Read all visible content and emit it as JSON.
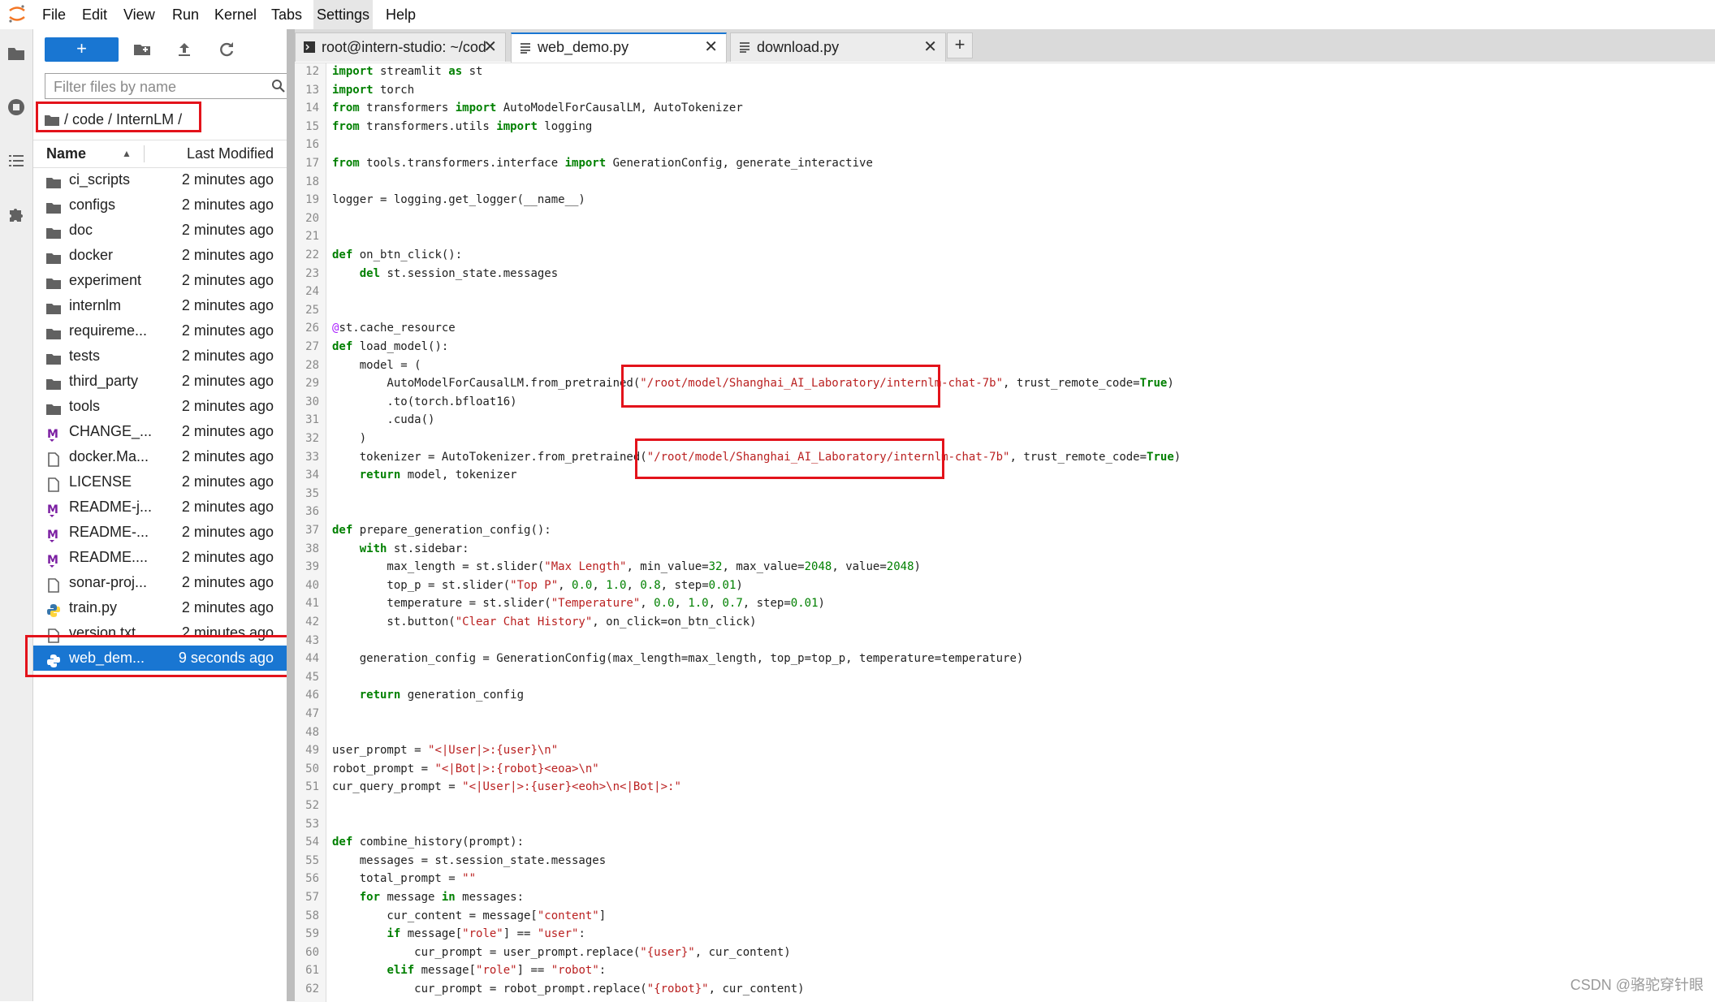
{
  "menubar": {
    "items": [
      "File",
      "Edit",
      "View",
      "Run",
      "Kernel",
      "Tabs",
      "Settings",
      "Help"
    ]
  },
  "filebrowser": {
    "new_label": "+",
    "filter_placeholder": "Filter files by name",
    "breadcrumb": "/ code / InternLM /",
    "header_name": "Name",
    "header_modified": "Last Modified",
    "files": [
      {
        "name": "ci_scripts",
        "modified": "2 minutes ago",
        "icon": "folder-icon"
      },
      {
        "name": "configs",
        "modified": "2 minutes ago",
        "icon": "folder-icon"
      },
      {
        "name": "doc",
        "modified": "2 minutes ago",
        "icon": "folder-icon"
      },
      {
        "name": "docker",
        "modified": "2 minutes ago",
        "icon": "folder-icon"
      },
      {
        "name": "experiment",
        "modified": "2 minutes ago",
        "icon": "folder-icon"
      },
      {
        "name": "internlm",
        "modified": "2 minutes ago",
        "icon": "folder-icon"
      },
      {
        "name": "requireme...",
        "modified": "2 minutes ago",
        "icon": "folder-icon"
      },
      {
        "name": "tests",
        "modified": "2 minutes ago",
        "icon": "folder-icon"
      },
      {
        "name": "third_party",
        "modified": "2 minutes ago",
        "icon": "folder-icon"
      },
      {
        "name": "tools",
        "modified": "2 minutes ago",
        "icon": "folder-icon"
      },
      {
        "name": "CHANGE_...",
        "modified": "2 minutes ago",
        "icon": "markdown-icon"
      },
      {
        "name": "docker.Ma...",
        "modified": "2 minutes ago",
        "icon": "file-icon"
      },
      {
        "name": "LICENSE",
        "modified": "2 minutes ago",
        "icon": "file-icon"
      },
      {
        "name": "README-j...",
        "modified": "2 minutes ago",
        "icon": "markdown-icon"
      },
      {
        "name": "README-...",
        "modified": "2 minutes ago",
        "icon": "markdown-icon"
      },
      {
        "name": "README....",
        "modified": "2 minutes ago",
        "icon": "markdown-icon"
      },
      {
        "name": "sonar-proj...",
        "modified": "2 minutes ago",
        "icon": "file-icon"
      },
      {
        "name": "train.py",
        "modified": "2 minutes ago",
        "icon": "python-icon"
      },
      {
        "name": "version.txt",
        "modified": "2 minutes ago",
        "icon": "file-icon"
      },
      {
        "name": "web_dem...",
        "modified": "9 seconds ago",
        "icon": "python-icon",
        "selected": true
      }
    ]
  },
  "tabs": [
    {
      "label": "root@intern-studio: ~/cod",
      "icon": "terminal-icon",
      "active": false
    },
    {
      "label": "web_demo.py",
      "icon": "text-file-icon",
      "active": true
    },
    {
      "label": "download.py",
      "icon": "text-file-icon",
      "active": false
    }
  ],
  "tab_add_label": "+",
  "editor": {
    "lines": [
      {
        "n": "12",
        "t": "import streamlit as st"
      },
      {
        "n": "13",
        "t": "import torch"
      },
      {
        "n": "14",
        "t": "from transformers import AutoModelForCausalLM, AutoTokenizer"
      },
      {
        "n": "15",
        "t": "from transformers.utils import logging"
      },
      {
        "n": "16",
        "t": ""
      },
      {
        "n": "17",
        "t": "from tools.transformers.interface import GenerationConfig, generate_interactive"
      },
      {
        "n": "18",
        "t": ""
      },
      {
        "n": "19",
        "t": "logger = logging.get_logger(__name__)"
      },
      {
        "n": "20",
        "t": ""
      },
      {
        "n": "21",
        "t": ""
      },
      {
        "n": "22",
        "t": "def on_btn_click():"
      },
      {
        "n": "23",
        "t": "    del st.session_state.messages"
      },
      {
        "n": "24",
        "t": ""
      },
      {
        "n": "25",
        "t": ""
      },
      {
        "n": "26",
        "t": "@st.cache_resource"
      },
      {
        "n": "27",
        "t": "def load_model():"
      },
      {
        "n": "28",
        "t": "    model = ("
      },
      {
        "n": "29",
        "t": "        AutoModelForCausalLM.from_pretrained(\"/root/model/Shanghai_AI_Laboratory/internlm-chat-7b\", trust_remote_code=True)"
      },
      {
        "n": "30",
        "t": "        .to(torch.bfloat16)"
      },
      {
        "n": "31",
        "t": "        .cuda()"
      },
      {
        "n": "32",
        "t": "    )"
      },
      {
        "n": "33",
        "t": "    tokenizer = AutoTokenizer.from_pretrained(\"/root/model/Shanghai_AI_Laboratory/internlm-chat-7b\", trust_remote_code=True)"
      },
      {
        "n": "34",
        "t": "    return model, tokenizer"
      },
      {
        "n": "35",
        "t": ""
      },
      {
        "n": "36",
        "t": ""
      },
      {
        "n": "37",
        "t": "def prepare_generation_config():"
      },
      {
        "n": "38",
        "t": "    with st.sidebar:"
      },
      {
        "n": "39",
        "t": "        max_length = st.slider(\"Max Length\", min_value=32, max_value=2048, value=2048)"
      },
      {
        "n": "40",
        "t": "        top_p = st.slider(\"Top P\", 0.0, 1.0, 0.8, step=0.01)"
      },
      {
        "n": "41",
        "t": "        temperature = st.slider(\"Temperature\", 0.0, 1.0, 0.7, step=0.01)"
      },
      {
        "n": "42",
        "t": "        st.button(\"Clear Chat History\", on_click=on_btn_click)"
      },
      {
        "n": "43",
        "t": ""
      },
      {
        "n": "44",
        "t": "    generation_config = GenerationConfig(max_length=max_length, top_p=top_p, temperature=temperature)"
      },
      {
        "n": "45",
        "t": ""
      },
      {
        "n": "46",
        "t": "    return generation_config"
      },
      {
        "n": "47",
        "t": ""
      },
      {
        "n": "48",
        "t": ""
      },
      {
        "n": "49",
        "t": "user_prompt = \"<|User|>:{user}\\n\""
      },
      {
        "n": "50",
        "t": "robot_prompt = \"<|Bot|>:{robot}<eoa>\\n\""
      },
      {
        "n": "51",
        "t": "cur_query_prompt = \"<|User|>:{user}<eoh>\\n<|Bot|>:\""
      },
      {
        "n": "52",
        "t": ""
      },
      {
        "n": "53",
        "t": ""
      },
      {
        "n": "54",
        "t": "def combine_history(prompt):"
      },
      {
        "n": "55",
        "t": "    messages = st.session_state.messages"
      },
      {
        "n": "56",
        "t": "    total_prompt = \"\""
      },
      {
        "n": "57",
        "t": "    for message in messages:"
      },
      {
        "n": "58",
        "t": "        cur_content = message[\"content\"]"
      },
      {
        "n": "59",
        "t": "        if message[\"role\"] == \"user\":"
      },
      {
        "n": "60",
        "t": "            cur_prompt = user_prompt.replace(\"{user}\", cur_content)"
      },
      {
        "n": "61",
        "t": "        elif message[\"role\"] == \"robot\":"
      },
      {
        "n": "62",
        "t": "            cur_prompt = robot_prompt.replace(\"{robot}\", cur_content)"
      }
    ]
  },
  "watermark": "CSDN @骆驼穿针眼",
  "colors": {
    "accent": "#1976d2",
    "highlight_box": "#e3131b"
  }
}
